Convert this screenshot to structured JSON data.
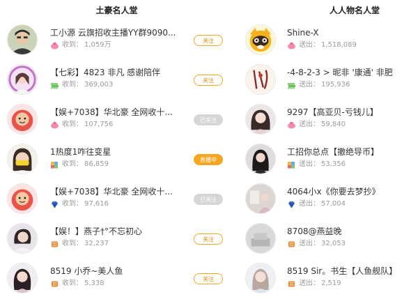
{
  "left": {
    "title": "土豪名人堂",
    "rows": [
      {
        "name": "工小源 云旗招收主播YY群9090...",
        "stat_label": "收到：",
        "stat_value": "1,059万",
        "gift": "bag-icon",
        "button": "关注",
        "button_state": "follow"
      },
      {
        "name": "【七彩】4823 非凡 感谢陪伴",
        "stat_label": "收到：",
        "stat_value": "369,003",
        "gift": "stack-icon",
        "button": "关注",
        "button_state": "follow"
      },
      {
        "name": "【娱+7038】华北豪 全网收十...",
        "stat_label": "收到：",
        "stat_value": "107,756",
        "gift": "bag-icon",
        "button": "已关注",
        "button_state": "followed"
      },
      {
        "name": "1热度1咋往变星",
        "stat_label": "收到：",
        "stat_value": "86,859",
        "gift": "colorful-icon",
        "button": "直播中",
        "button_state": "live"
      },
      {
        "name": "【娱+7038】华北豪 全网收十...",
        "stat_label": "收到：",
        "stat_value": "97,616",
        "gift": "gem-icon",
        "button": "已关注",
        "button_state": "followed"
      },
      {
        "name": "【娱！】燕子†°不忘初心",
        "stat_label": "收到：",
        "stat_value": "32,237",
        "gift": "scroll-icon",
        "button": "关注",
        "button_state": "follow"
      },
      {
        "name": "8519 小乔~美人鱼",
        "stat_label": "收到：",
        "stat_value": "5,338",
        "gift": "scroll-icon",
        "button": "关注",
        "button_state": "follow"
      }
    ]
  },
  "right": {
    "title": "人人物名人堂",
    "rows": [
      {
        "name": "Shine-X",
        "stat_label": "送出：",
        "stat_value": "1,518,089",
        "gift": "bag-icon"
      },
      {
        "name": "-4-8-2-3 > 昵非 '康通' 非肥",
        "stat_label": "送出：",
        "stat_value": "195,936",
        "gift": "stack-icon"
      },
      {
        "name": "9297【高亚贝-亏钱儿】",
        "stat_label": "送出：",
        "stat_value": "59,840",
        "gift": "bag-icon"
      },
      {
        "name": "工招你总点【撤绝导币】",
        "stat_label": "送出：",
        "stat_value": "53,356",
        "gift": "colorful-icon"
      },
      {
        "name": "4064小x《你要去梦抄》",
        "stat_label": "送出：",
        "stat_value": "57,004",
        "gift": "gem-icon"
      },
      {
        "name": "8708@燕益晚",
        "stat_label": "送出：",
        "stat_value": "32,053",
        "gift": "scroll-icon"
      },
      {
        "name": "8519 Sir。书生【人鱼舰队】",
        "stat_label": "送出：",
        "stat_value": "2,519",
        "gift": "scroll-icon"
      }
    ]
  },
  "colors": {
    "accent": "#f5a623",
    "followed": "#d6d6d6"
  }
}
